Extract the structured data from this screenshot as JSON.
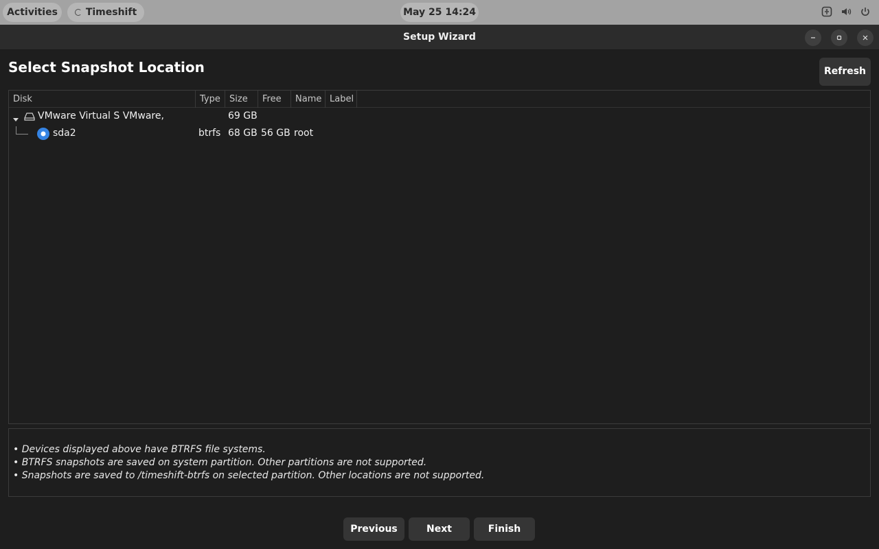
{
  "topbar": {
    "activities": "Activities",
    "app_name": "Timeshift",
    "clock": "May 25  14:24",
    "tray_icons": [
      "accessibility-icon",
      "volume-icon",
      "power-icon"
    ]
  },
  "window": {
    "title": "Setup Wizard"
  },
  "page": {
    "heading": "Select Snapshot Location",
    "refresh_label": "Refresh"
  },
  "table": {
    "columns": [
      "Disk",
      "Type",
      "Size",
      "Free",
      "Name",
      "Label"
    ],
    "disk": {
      "name": "VMware Virtual S VMware,",
      "size": "69 GB",
      "icon": "drive-icon",
      "expanded": true
    },
    "partition": {
      "name": "sda2",
      "type": "btrfs",
      "size": "68 GB",
      "free": "56 GB",
      "fs_name": "root",
      "label": "",
      "selected": true
    }
  },
  "notes": [
    "• Devices displayed above have BTRFS file systems.",
    "• BTRFS snapshots are saved on system partition. Other partitions are not supported.",
    "• Snapshots are saved to /timeshift-btrfs on selected partition. Other locations are not supported."
  ],
  "nav": {
    "previous": "Previous",
    "next": "Next",
    "finish": "Finish"
  },
  "colors": {
    "accent": "#3584e4",
    "background": "#1e1e1e",
    "button": "#353535",
    "topbar": "#a3a3a3"
  }
}
